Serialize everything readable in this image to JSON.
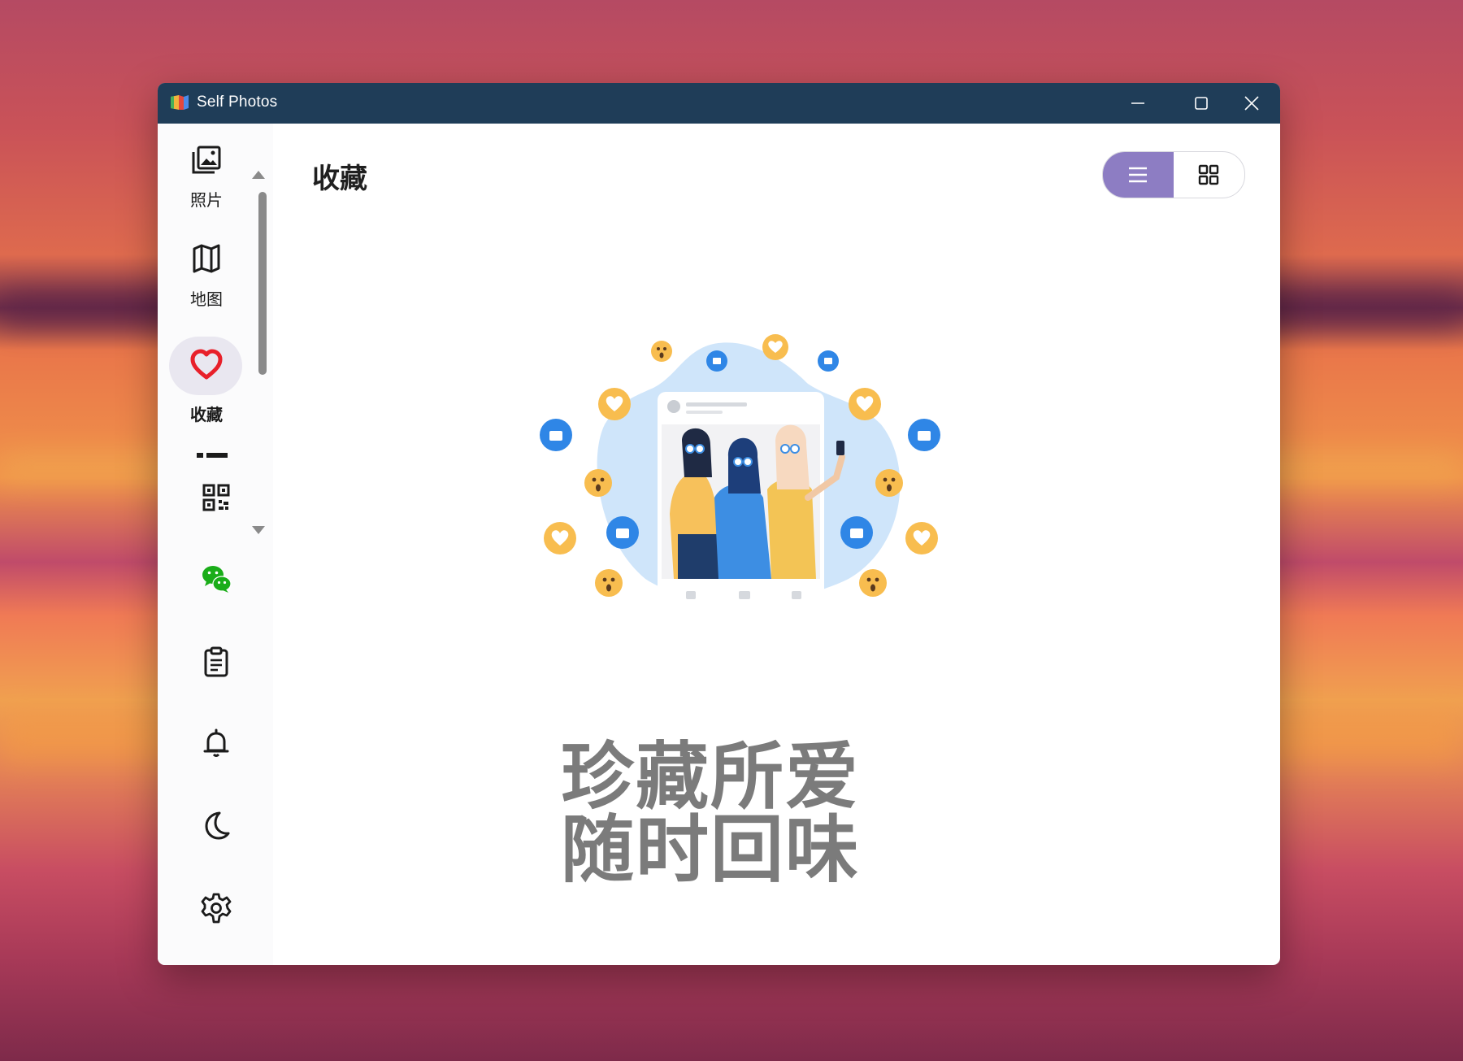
{
  "window": {
    "title": "Self Photos",
    "controls": {
      "minimize": "minimize",
      "maximize": "maximize",
      "close": "close"
    }
  },
  "sidebar": {
    "items": [
      {
        "label": "照片",
        "icon": "photo-library-icon"
      },
      {
        "label": "地图",
        "icon": "map-icon"
      },
      {
        "label": "收藏",
        "icon": "heart-icon",
        "active": true
      }
    ],
    "tools": [
      {
        "icon": "qr-code-icon"
      },
      {
        "icon": "wechat-icon"
      },
      {
        "icon": "clipboard-icon"
      },
      {
        "icon": "bell-icon"
      },
      {
        "icon": "moon-icon"
      },
      {
        "icon": "settings-icon"
      }
    ]
  },
  "main": {
    "title": "收藏",
    "view_toggle": {
      "selected": "list",
      "options": [
        "list",
        "grid"
      ]
    },
    "empty_state": {
      "line1": "珍藏所爱",
      "line2": "随时回味"
    }
  },
  "colors": {
    "titlebar": "#1f3d58",
    "accent": "#8d7dc3",
    "heart": "#e8202a",
    "empty_text": "#7b7b7b"
  }
}
